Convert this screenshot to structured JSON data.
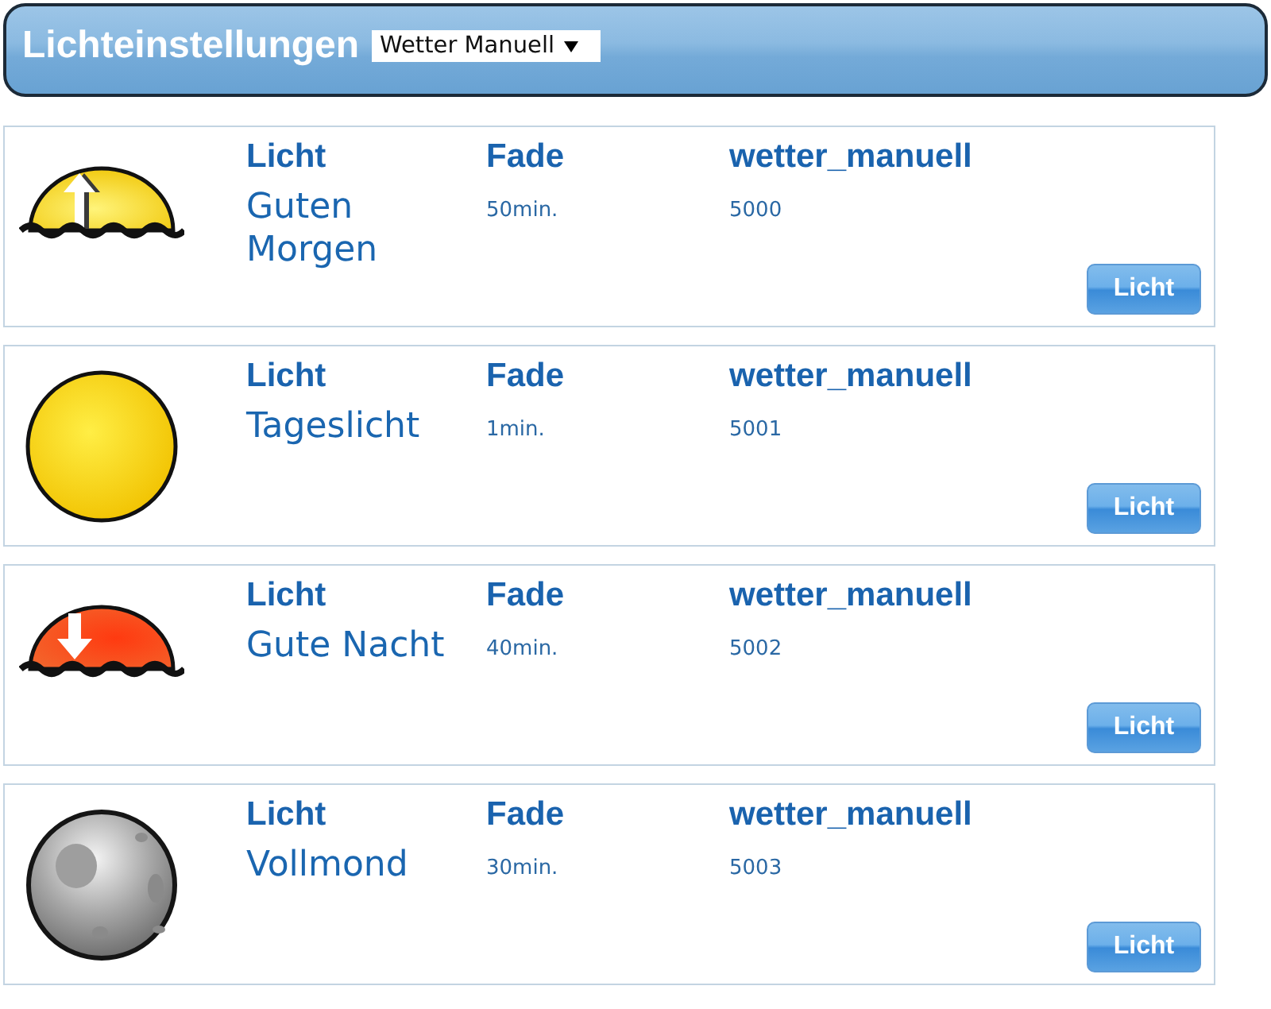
{
  "header": {
    "title": "Lichteinstellungen",
    "select": {
      "value": "Wetter Manuell"
    }
  },
  "lights": [
    {
      "kind": "sunrise",
      "label": "Licht",
      "name": "Guten Morgen",
      "fade_label": "Fade",
      "fade": "50min.",
      "group_label": "wetter_manuell",
      "number": "5000",
      "button": "Licht"
    },
    {
      "kind": "sun",
      "label": "Licht",
      "name": "Tageslicht",
      "fade_label": "Fade",
      "fade": "1min.",
      "group_label": "wetter_manuell",
      "number": "5001",
      "button": "Licht"
    },
    {
      "kind": "sunset",
      "label": "Licht",
      "name": "Gute Nacht",
      "fade_label": "Fade",
      "fade": "40min.",
      "group_label": "wetter_manuell",
      "number": "5002",
      "button": "Licht"
    },
    {
      "kind": "moon",
      "label": "Licht",
      "name": "Vollmond",
      "fade_label": "Fade",
      "fade": "30min.",
      "group_label": "wetter_manuell",
      "number": "5003",
      "button": "Licht"
    }
  ]
}
